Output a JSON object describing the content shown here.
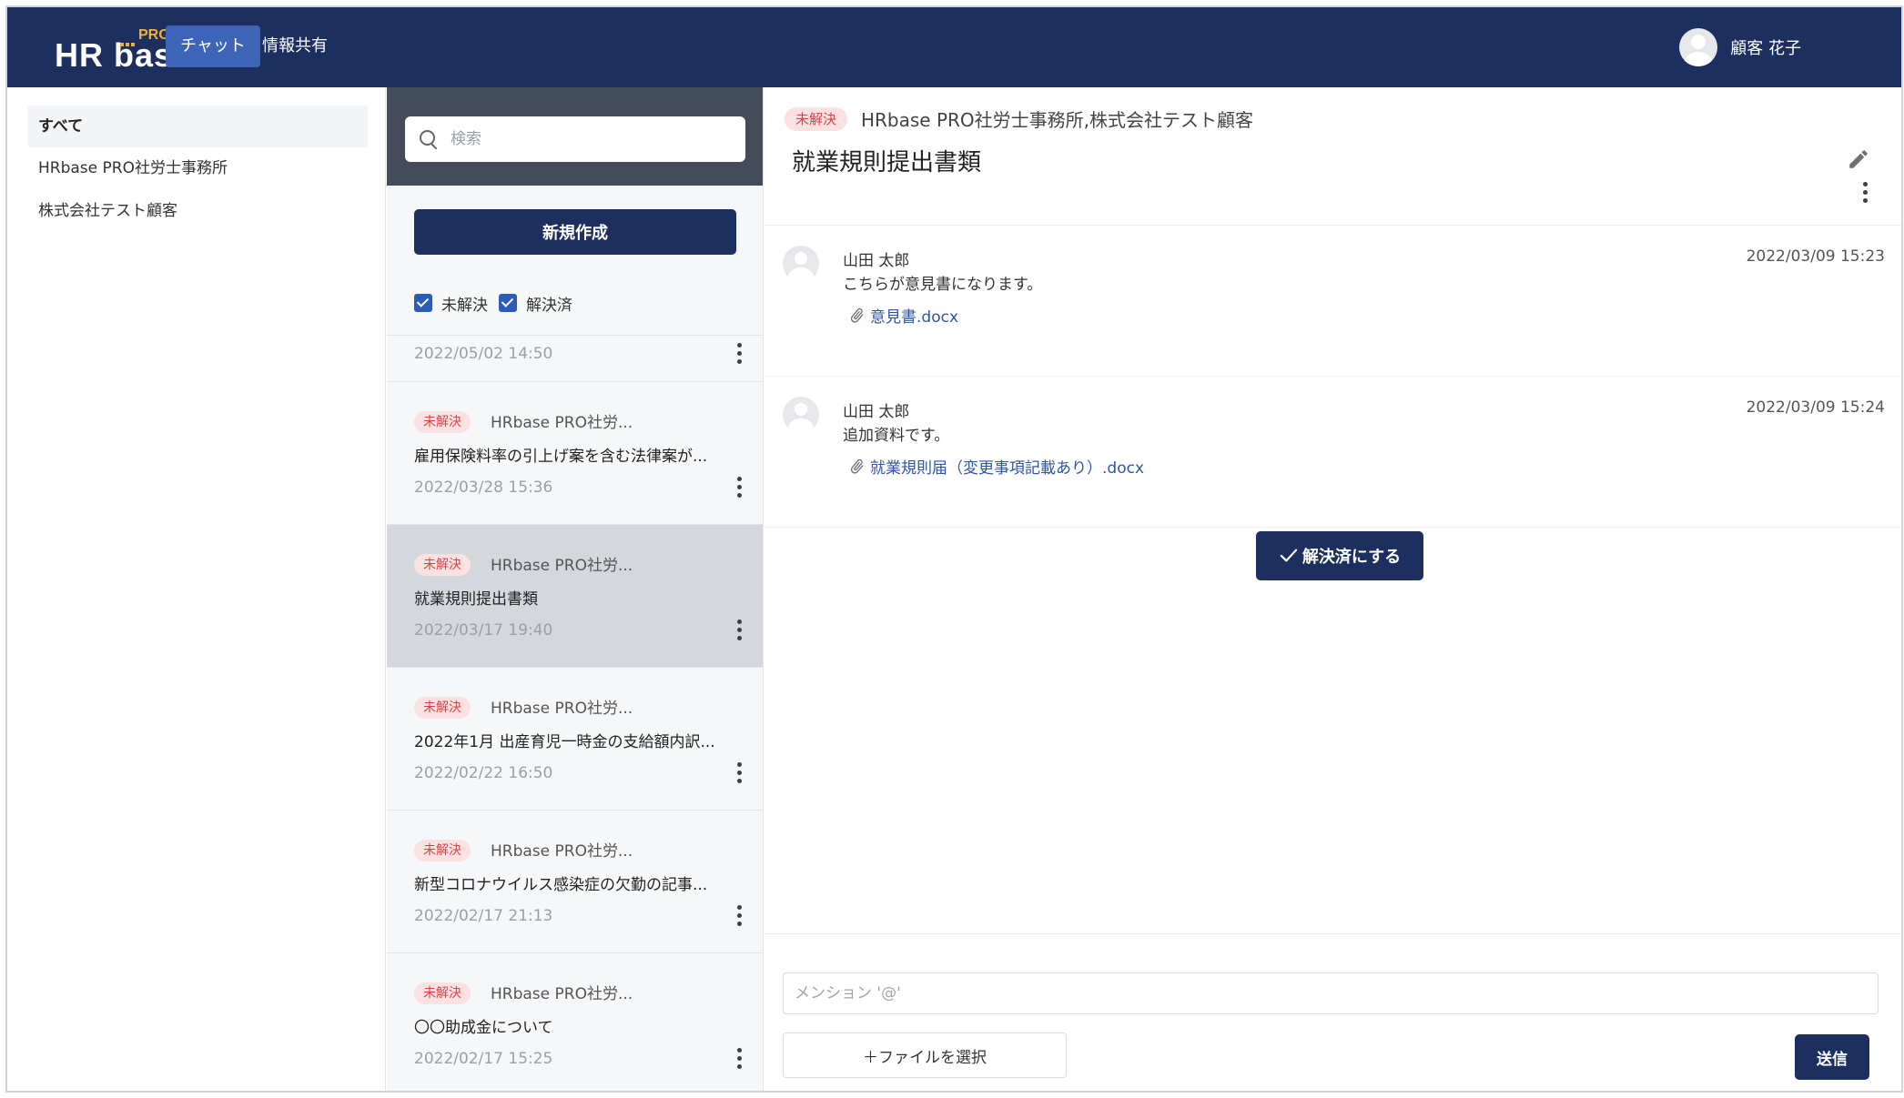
{
  "header": {
    "logo_main": "HR base",
    "logo_pro": "PRO",
    "tabs": [
      {
        "label": "チャット",
        "active": true
      },
      {
        "label": "情報共有",
        "active": false
      }
    ],
    "user_name": "顧客 花子"
  },
  "sidebar": {
    "items": [
      {
        "label": "すべて",
        "active": true
      },
      {
        "label": "HRbase PRO社労士事務所",
        "active": false
      },
      {
        "label": "株式会社テスト顧客",
        "active": false
      }
    ]
  },
  "threads": {
    "search_placeholder": "検索",
    "new_button": "新規作成",
    "filters": [
      {
        "label": "未解決",
        "checked": true
      },
      {
        "label": "解決済",
        "checked": true
      }
    ],
    "partial_date": "2022/05/02 14:50",
    "items": [
      {
        "badge": "未解決",
        "org": "HRbase PRO社労...",
        "title": "雇用保険料率の引上げ案を含む法律案が...",
        "date": "2022/03/28 15:36",
        "selected": false
      },
      {
        "badge": "未解決",
        "org": "HRbase PRO社労...",
        "title": "就業規則提出書類",
        "date": "2022/03/17 19:40",
        "selected": true
      },
      {
        "badge": "未解決",
        "org": "HRbase PRO社労...",
        "title": "2022年1月 出産育児一時金の支給額内訳...",
        "date": "2022/02/22 16:50",
        "selected": false
      },
      {
        "badge": "未解決",
        "org": "HRbase PRO社労...",
        "title": "新型コロナウイルス感染症の欠勤の記事...",
        "date": "2022/02/17 21:13",
        "selected": false
      },
      {
        "badge": "未解決",
        "org": "HRbase PRO社労...",
        "title": "〇〇助成金について",
        "date": "2022/02/17 15:25",
        "selected": false
      }
    ]
  },
  "main": {
    "badge": "未解決",
    "org": "HRbase PRO社労士事務所,株式会社テスト顧客",
    "title": "就業規則提出書類",
    "messages": [
      {
        "author": "山田 太郎",
        "body": "こちらが意見書になります。",
        "time": "2022/03/09 15:23",
        "file": "意見書.docx"
      },
      {
        "author": "山田 太郎",
        "body": "追加資料です。",
        "time": "2022/03/09 15:24",
        "file": "就業規則届（変更事項記載あり）.docx"
      }
    ],
    "resolve_button": "解決済にする",
    "mention_placeholder": "メンション '@'",
    "file_button": "＋ファイルを選択",
    "send_button": "送信"
  },
  "colors": {
    "header_bg": "#1c2f5e",
    "accent": "#3e64b8",
    "badge_bg": "#fbe1e1",
    "badge_text": "#d64545",
    "link": "#2d56a6"
  }
}
